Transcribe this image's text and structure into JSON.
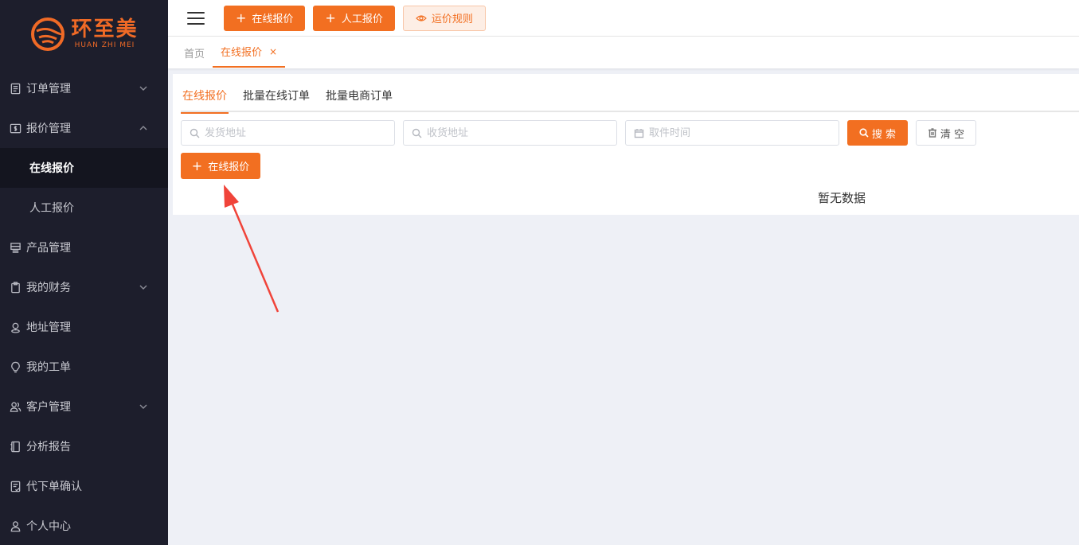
{
  "brand": {
    "name_cn": "环至美",
    "name_en": "HUAN ZHI MEI",
    "color": "#f06a26"
  },
  "sidebar": {
    "items": [
      {
        "label": "订单管理",
        "icon": "document-list-icon",
        "expandable": true,
        "expanded": false
      },
      {
        "label": "报价管理",
        "icon": "dollar-card-icon",
        "expandable": true,
        "expanded": true,
        "children": [
          {
            "label": "在线报价",
            "active": true
          },
          {
            "label": "人工报价",
            "active": false
          }
        ]
      },
      {
        "label": "产品管理",
        "icon": "server-stack-icon",
        "expandable": false
      },
      {
        "label": "我的财务",
        "icon": "clipboard-icon",
        "expandable": true,
        "expanded": false
      },
      {
        "label": "地址管理",
        "icon": "map-pin-icon",
        "expandable": false
      },
      {
        "label": "我的工单",
        "icon": "bulb-icon",
        "expandable": false
      },
      {
        "label": "客户管理",
        "icon": "users-icon",
        "expandable": true,
        "expanded": false
      },
      {
        "label": "分析报告",
        "icon": "notebook-icon",
        "expandable": false
      },
      {
        "label": "代下单确认",
        "icon": "checklist-icon",
        "expandable": false
      },
      {
        "label": "个人中心",
        "icon": "user-icon",
        "expandable": false
      }
    ]
  },
  "toolbar": {
    "online_quote": "在线报价",
    "manual_quote": "人工报价",
    "shipping_rules": "运价规则"
  },
  "tabs": {
    "home": "首页",
    "active": "在线报价",
    "close": "×"
  },
  "main": {
    "subtabs": [
      "在线报价",
      "批量在线订单",
      "批量电商订单"
    ],
    "filters": {
      "ship_from_placeholder": "发货地址",
      "ship_to_placeholder": "收货地址",
      "pickup_time_placeholder": "取件时间"
    },
    "search_label": "搜 索",
    "clear_label": "清 空",
    "add_label": "在线报价",
    "empty_text": "暂无数据"
  },
  "colors": {
    "accent": "#f26f21",
    "sidebar_bg": "#1d1e2c",
    "annotation": "#f0443a"
  }
}
